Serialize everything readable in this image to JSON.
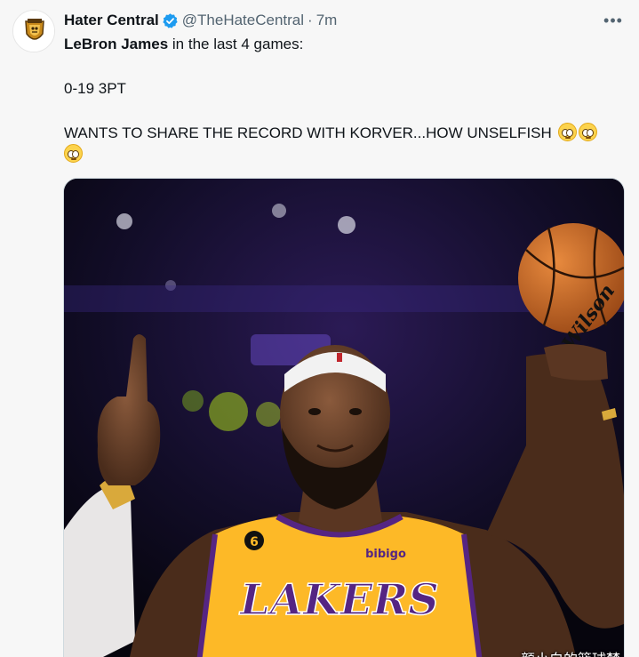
{
  "author": {
    "display_name": "Hater Central",
    "handle": "@TheHateCentral",
    "separator": "·",
    "timestamp": "7m",
    "verified": true
  },
  "more_icon": "more-horizontal-icon",
  "tweet": {
    "line1_name": "LeBron James",
    "line1_rest": " in the last 4 games:",
    "line2": "0-19 3PT",
    "line3": "WANTS TO SHARE THE RECORD WITH  KORVER...HOW UNSELFISH"
  },
  "media": {
    "jersey_text": "LAKERS",
    "sponsor_text": "bibigo",
    "ball_brand": "Wilson",
    "jersey_number_badge": "6"
  },
  "watermark": "颜小白的篮球梦",
  "colors": {
    "verified_blue": "#1d9bf0",
    "lakers_gold": "#fdb927",
    "lakers_purple": "#552583"
  }
}
